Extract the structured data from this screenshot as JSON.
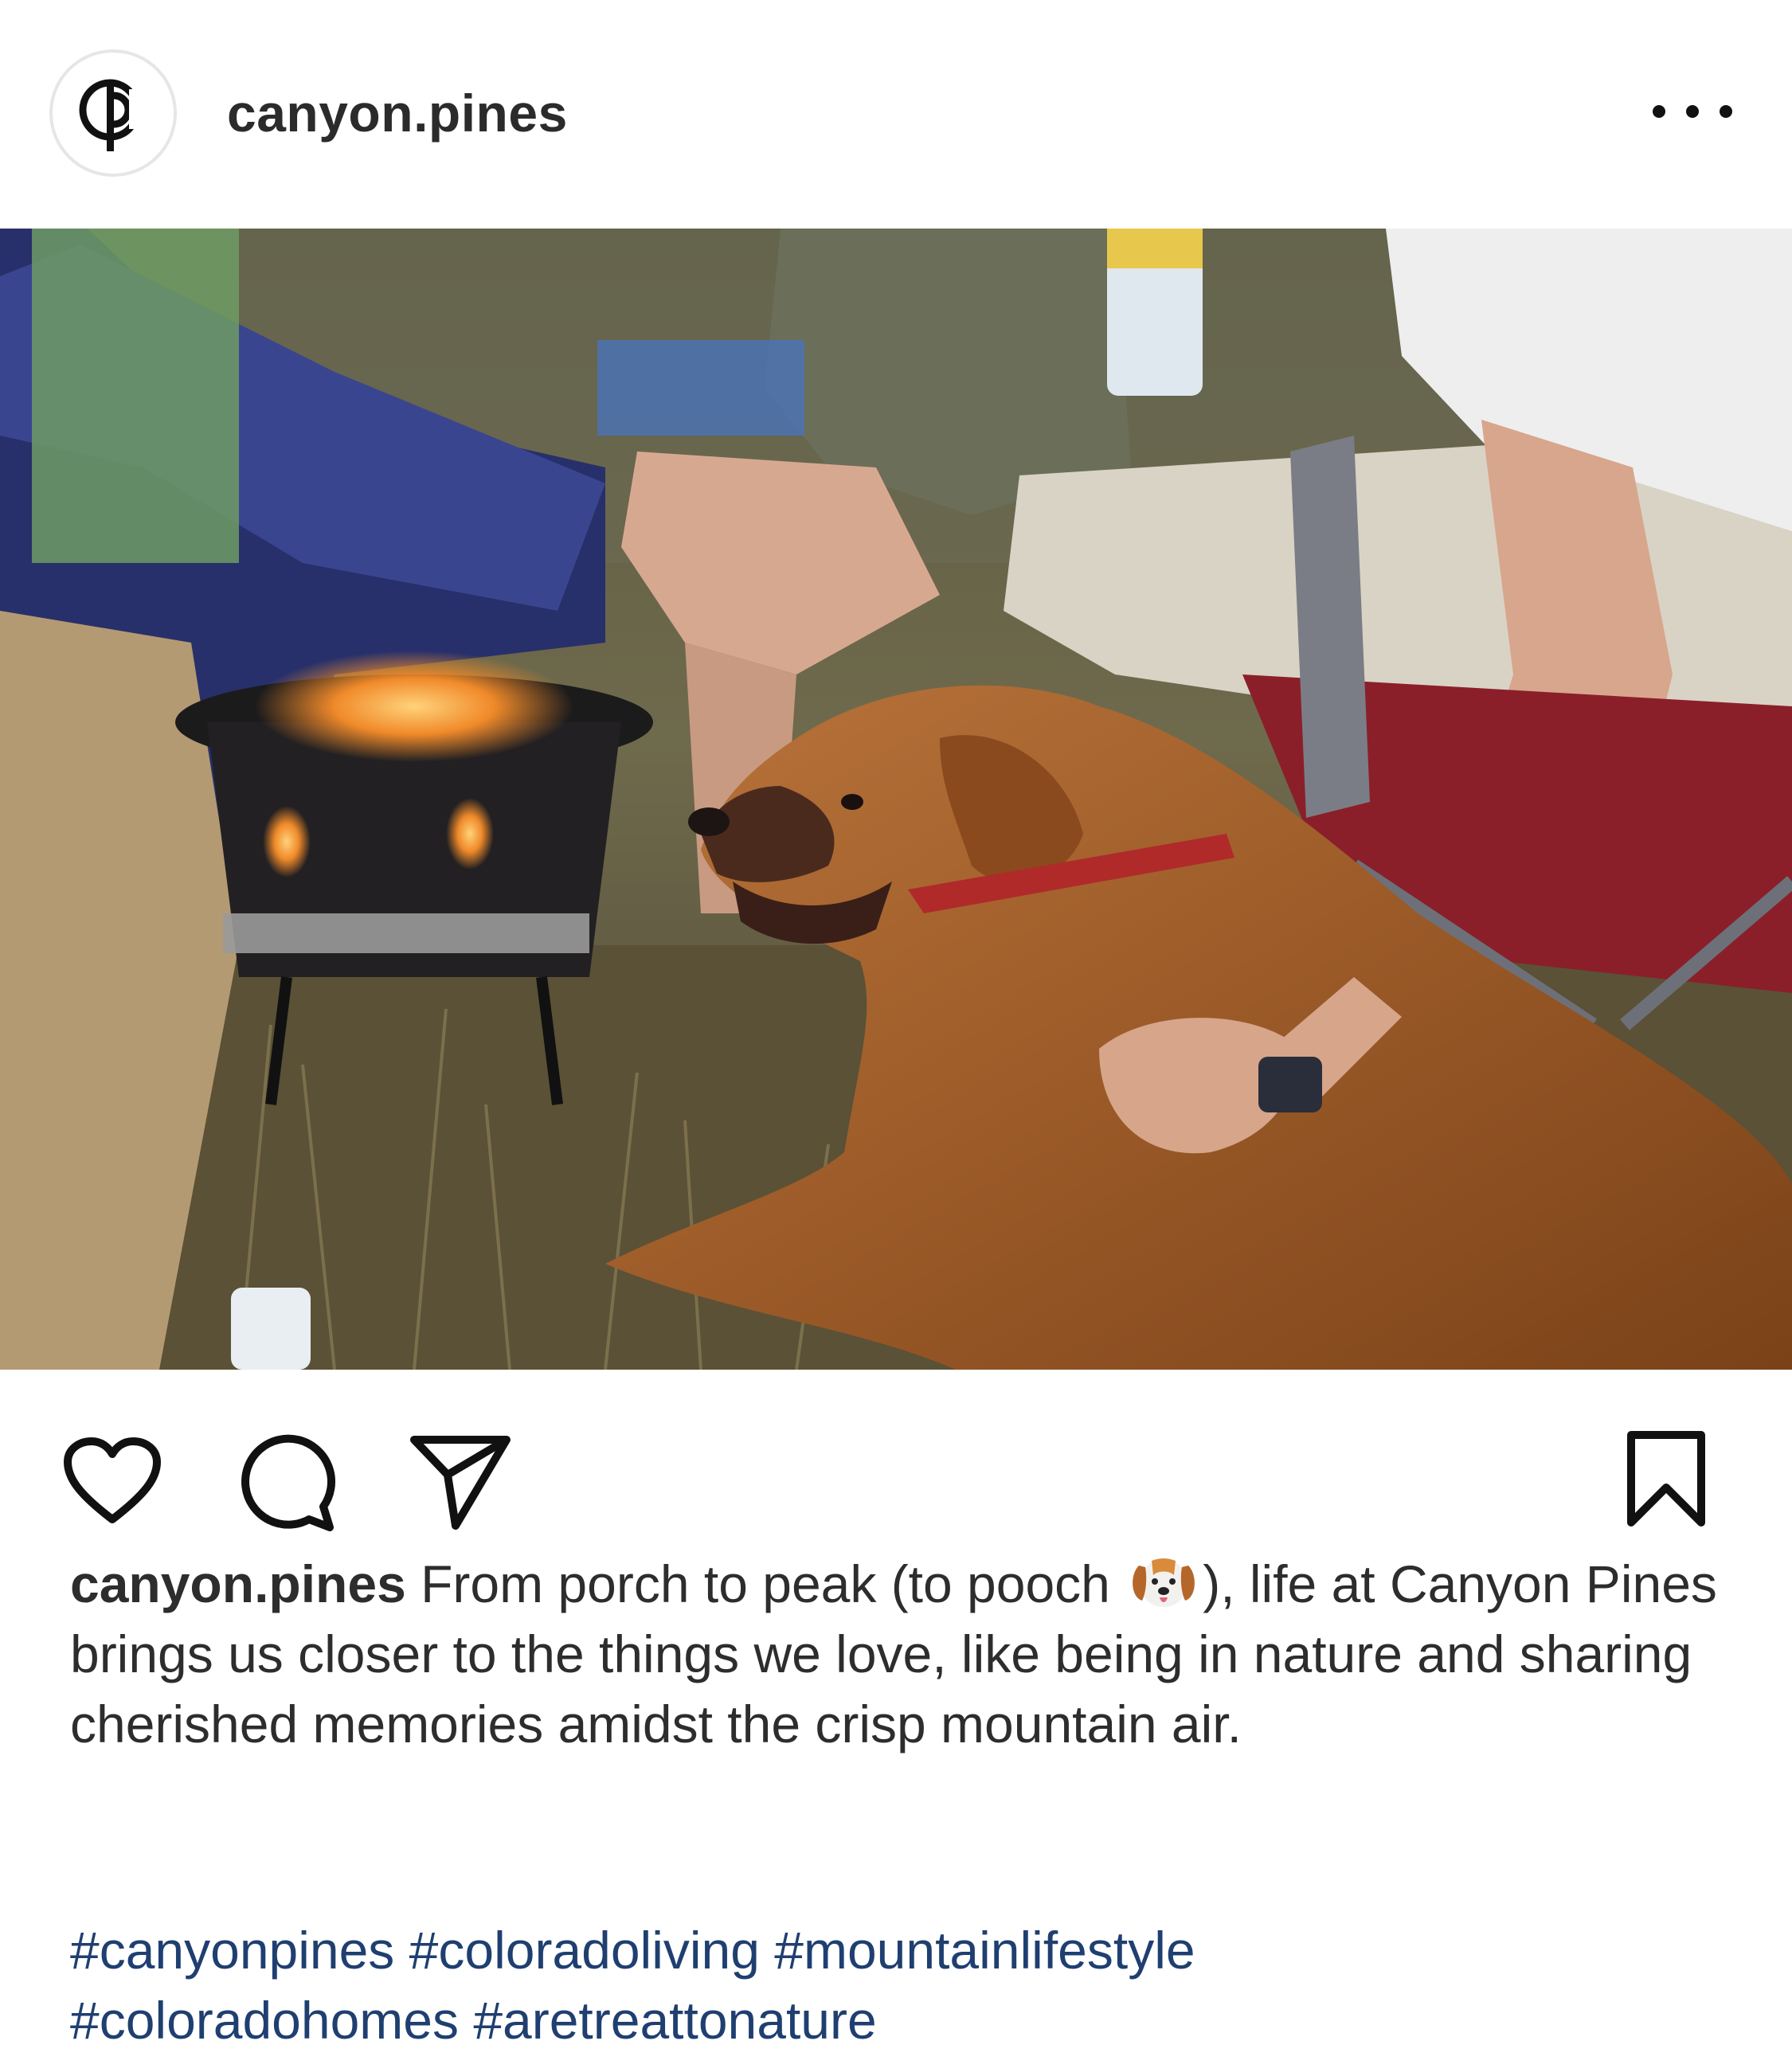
{
  "post": {
    "username": "canyon.pines",
    "avatar_icon": "cp-monogram-logo-icon",
    "more_icon": "more-options-icon"
  },
  "photo": {
    "alt_icon": "post-photo"
  },
  "actions": {
    "like_icon": "heart-icon",
    "comment_icon": "comment-icon",
    "share_icon": "paper-plane-icon",
    "save_icon": "bookmark-icon"
  },
  "caption": {
    "username": "canyon.pines",
    "text_before_emoji": " From porch to peak (to pooch ",
    "emoji_icon": "dog-face-emoji-icon",
    "text_after_emoji": "), life at Canyon Pines brings us closer to the things we love, like being in nature and sharing cherished memories amidst the crisp mountain air."
  },
  "hashtags": [
    "#canyonpines",
    "#coloradoliving",
    "#mountainlifestyle",
    "#coloradohomes",
    "#aretreattonature"
  ],
  "colors": {
    "hashtag": "#1f3f70",
    "text": "#2d2d2d",
    "icon": "#111111"
  }
}
